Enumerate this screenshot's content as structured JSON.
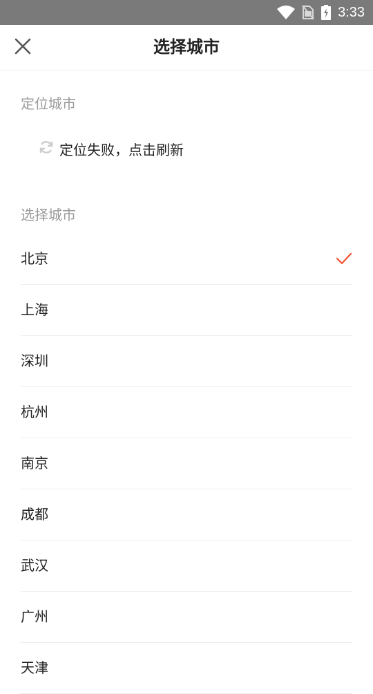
{
  "status_bar": {
    "time": "3:33",
    "icons": [
      "wifi-icon",
      "no-sim-icon",
      "battery-charging-icon"
    ]
  },
  "header": {
    "title": "选择城市",
    "close_icon": "close-icon"
  },
  "location": {
    "section_label": "定位城市",
    "status_text": "定位失败，点击刷新",
    "icon": "refresh-icon"
  },
  "cities": {
    "section_label": "选择城市",
    "selected": "北京",
    "accent_color": "#f0522f",
    "items": [
      {
        "label": "北京"
      },
      {
        "label": "上海"
      },
      {
        "label": "深圳"
      },
      {
        "label": "杭州"
      },
      {
        "label": "南京"
      },
      {
        "label": "成都"
      },
      {
        "label": "武汉"
      },
      {
        "label": "广州"
      },
      {
        "label": "天津"
      }
    ]
  }
}
